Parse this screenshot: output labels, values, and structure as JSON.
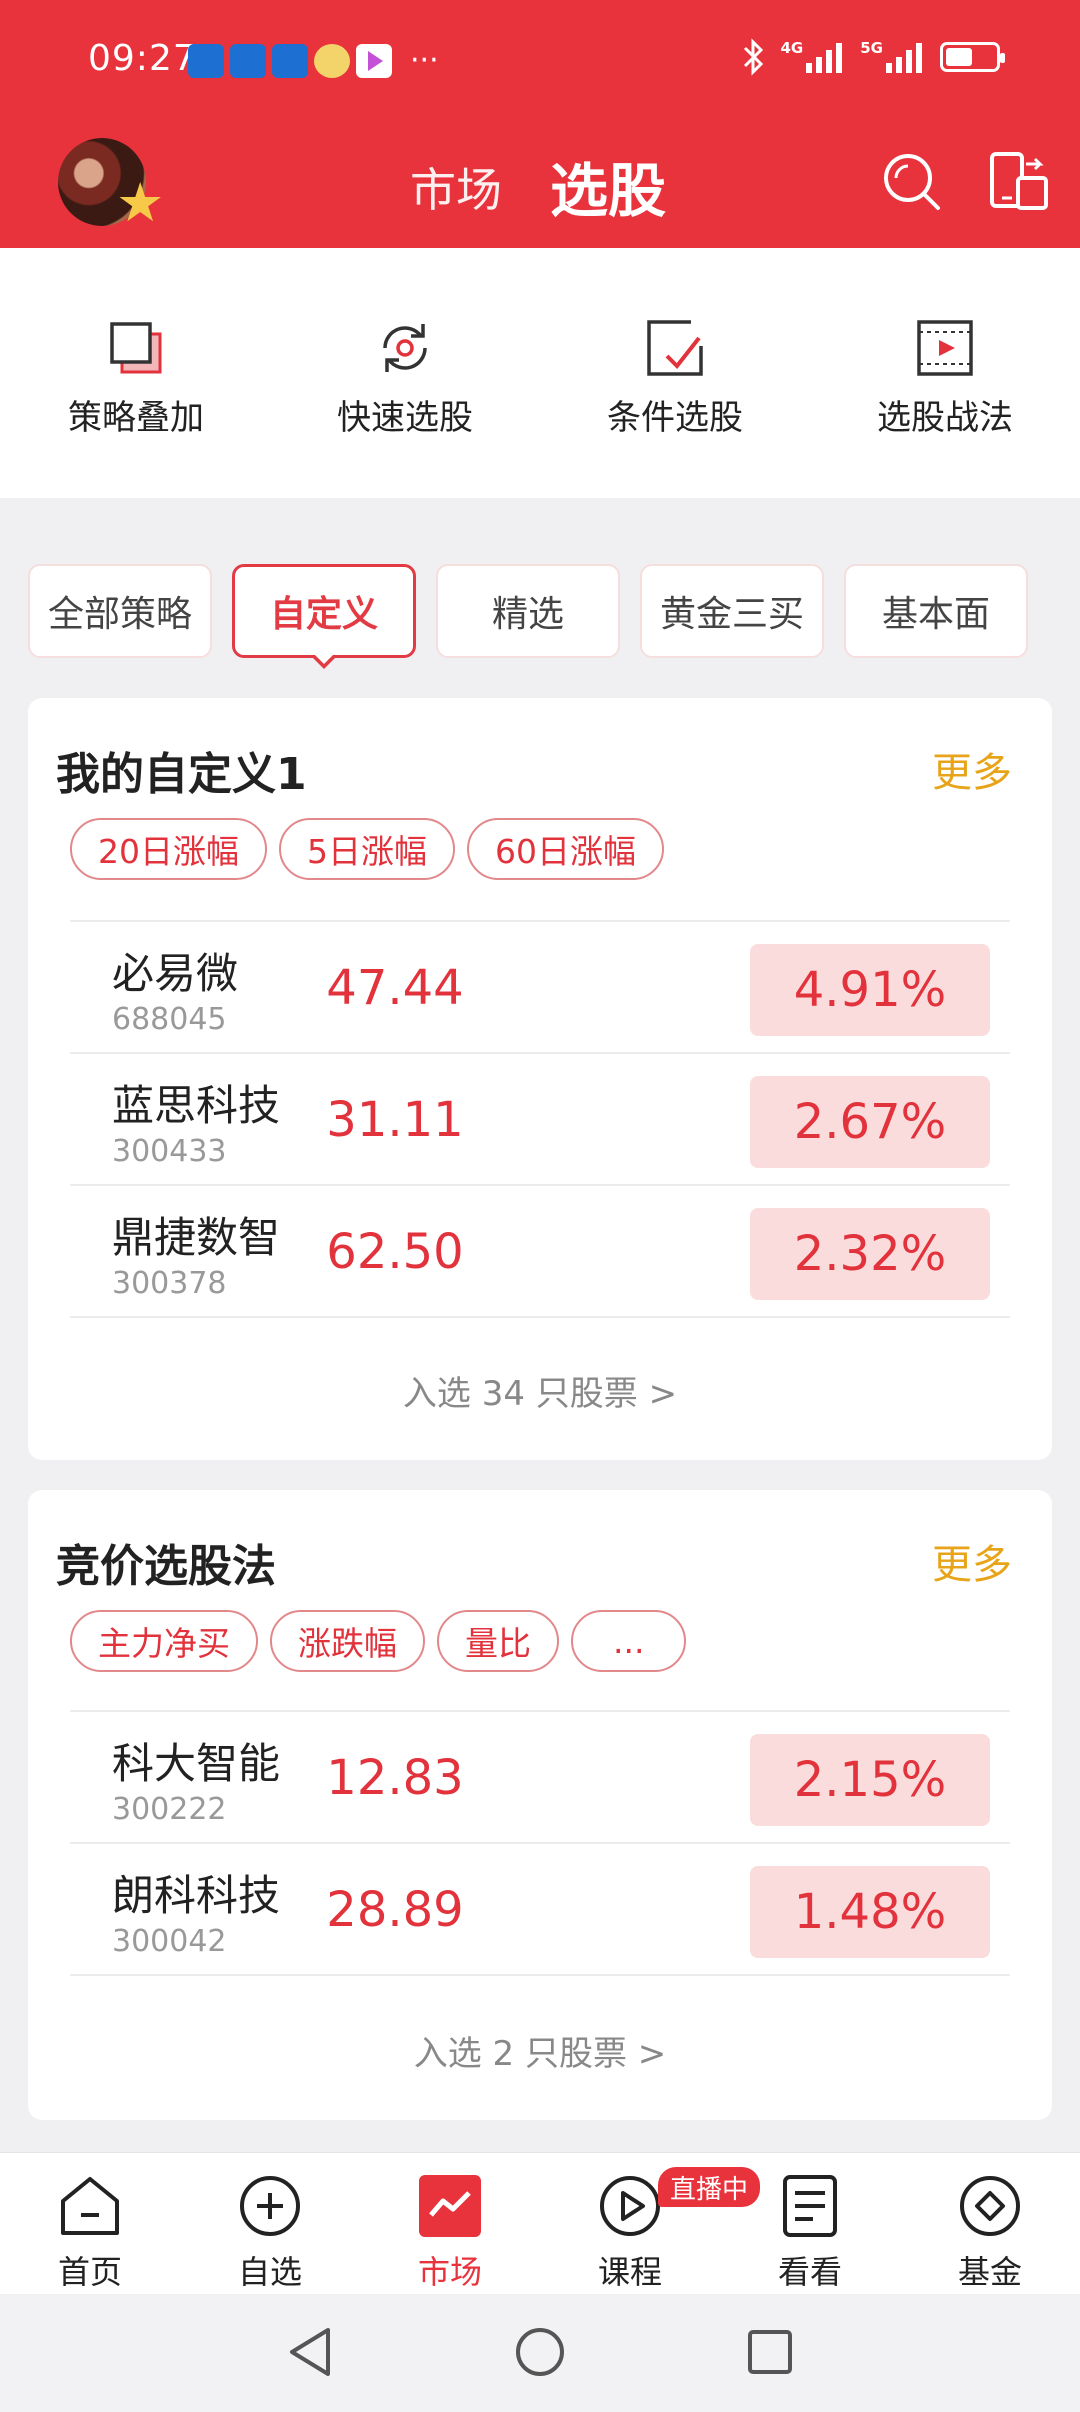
{
  "status_bar": {
    "time": "09:27",
    "more_dots": "···",
    "network_1": "4G",
    "network_2": "5G",
    "battery_level": 0.55,
    "app_icons": [
      "app-icon-1",
      "app-icon-2",
      "app-icon-3",
      "weather-icon",
      "video-app-icon"
    ]
  },
  "header": {
    "tab_market": "市场",
    "tab_stock_pick": "选股",
    "icons": [
      "avatar",
      "search-icon",
      "device-switch-icon"
    ]
  },
  "tools": [
    {
      "label": "策略叠加",
      "icon": "stack-icon"
    },
    {
      "label": "快速选股",
      "icon": "refresh-icon"
    },
    {
      "label": "条件选股",
      "icon": "checkbox-icon"
    },
    {
      "label": "选股战法",
      "icon": "video-icon"
    }
  ],
  "filter_chips": [
    {
      "label": "全部策略",
      "active": false
    },
    {
      "label": "自定义",
      "active": true
    },
    {
      "label": "精选",
      "active": false
    },
    {
      "label": "黄金三买",
      "active": false
    },
    {
      "label": "基本面",
      "active": false
    }
  ],
  "card1": {
    "title": "我的自定义1",
    "more": "更多",
    "pills": [
      "20日涨幅",
      "5日涨幅",
      "60日涨幅"
    ],
    "rows": [
      {
        "name": "必易微",
        "code": "688045",
        "price": "47.44",
        "change": "4.91%"
      },
      {
        "name": "蓝思科技",
        "code": "300433",
        "price": "31.11",
        "change": "2.67%"
      },
      {
        "name": "鼎捷数智",
        "code": "300378",
        "price": "62.50",
        "change": "2.32%"
      }
    ],
    "footer": "入选 34 只股票 >"
  },
  "card2": {
    "title": "竞价选股法",
    "more": "更多",
    "pills": [
      "主力净买",
      "涨跌幅",
      "量比",
      "..."
    ],
    "rows": [
      {
        "name": "科大智能",
        "code": "300222",
        "price": "12.83",
        "change": "2.15%"
      },
      {
        "name": "朗科科技",
        "code": "300042",
        "price": "28.89",
        "change": "1.48%"
      }
    ],
    "footer": "入选 2 只股票 >"
  },
  "bottom_nav": {
    "items": [
      {
        "label": "首页",
        "icon": "home-icon",
        "active": false
      },
      {
        "label": "自选",
        "icon": "plus-circle-icon",
        "active": false
      },
      {
        "label": "市场",
        "icon": "market-chart-icon",
        "active": true
      },
      {
        "label": "课程",
        "icon": "play-circle-icon",
        "active": false
      },
      {
        "label": "看看",
        "icon": "document-icon",
        "active": false
      },
      {
        "label": "基金",
        "icon": "fund-diamond-icon",
        "active": false
      }
    ],
    "live_badge": "直播中"
  },
  "colors": {
    "brand_red": "#e8333d",
    "up_red": "#e2323c",
    "more_orange": "#e8a418",
    "change_bg": "#fbdcdd"
  }
}
